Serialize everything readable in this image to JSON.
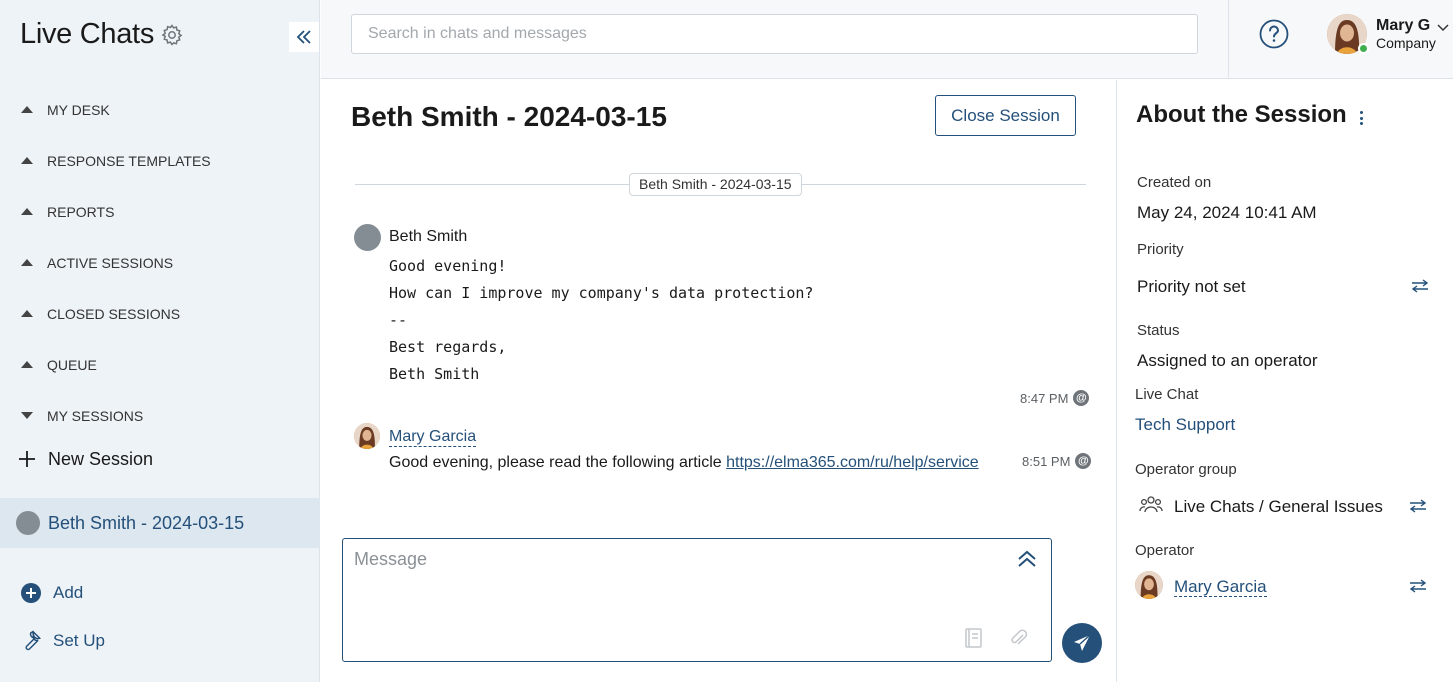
{
  "sidebar": {
    "app_title": "Live Chats",
    "nav": [
      {
        "label": "MY DESK",
        "expanded": false
      },
      {
        "label": "RESPONSE TEMPLATES",
        "expanded": false
      },
      {
        "label": "REPORTS",
        "expanded": false
      },
      {
        "label": "ACTIVE SESSIONS",
        "expanded": false
      },
      {
        "label": "CLOSED SESSIONS",
        "expanded": false
      },
      {
        "label": "QUEUE",
        "expanded": false
      },
      {
        "label": "MY SESSIONS",
        "expanded": true
      }
    ],
    "new_session": "New Session",
    "active_session": "Beth Smith - 2024-03-15",
    "add": "Add",
    "setup": "Set Up"
  },
  "topbar": {
    "search_placeholder": "Search in chats and messages",
    "user_name": "Mary G",
    "user_company": "Company"
  },
  "chat": {
    "title": "Beth Smith - 2024-03-15",
    "close_button": "Close Session",
    "separator": "Beth Smith - 2024-03-15",
    "messages": [
      {
        "author": "Beth Smith",
        "lines": [
          "Good evening!",
          "How can I improve my company's data protection?",
          "--",
          "Best regards,",
          "Beth Smith"
        ],
        "time": "8:47 PM"
      },
      {
        "author": "Mary Garcia",
        "text": "Good evening, please read the following article",
        "link": "https://elma365.com/ru/help/service",
        "time": "8:51 PM"
      }
    ],
    "composer_placeholder": "Message"
  },
  "info": {
    "title": "About the Session",
    "created_label": "Created on",
    "created_value": "May 24, 2024 10:41 AM",
    "priority_label": "Priority",
    "priority_value": "Priority not set",
    "status_label": "Status",
    "status_value": "Assigned to an operator",
    "livechat_label": "Live Chat",
    "livechat_value": "Tech Support",
    "opgroup_label": "Operator group",
    "opgroup_value": "Live Chats / General Issues",
    "operator_label": "Operator",
    "operator_value": "Mary Garcia"
  },
  "colors": {
    "accent": "#24507a",
    "sidebar_bg": "#eef3f8",
    "selected_bg": "#dde7f0",
    "online": "#3fae4f"
  }
}
